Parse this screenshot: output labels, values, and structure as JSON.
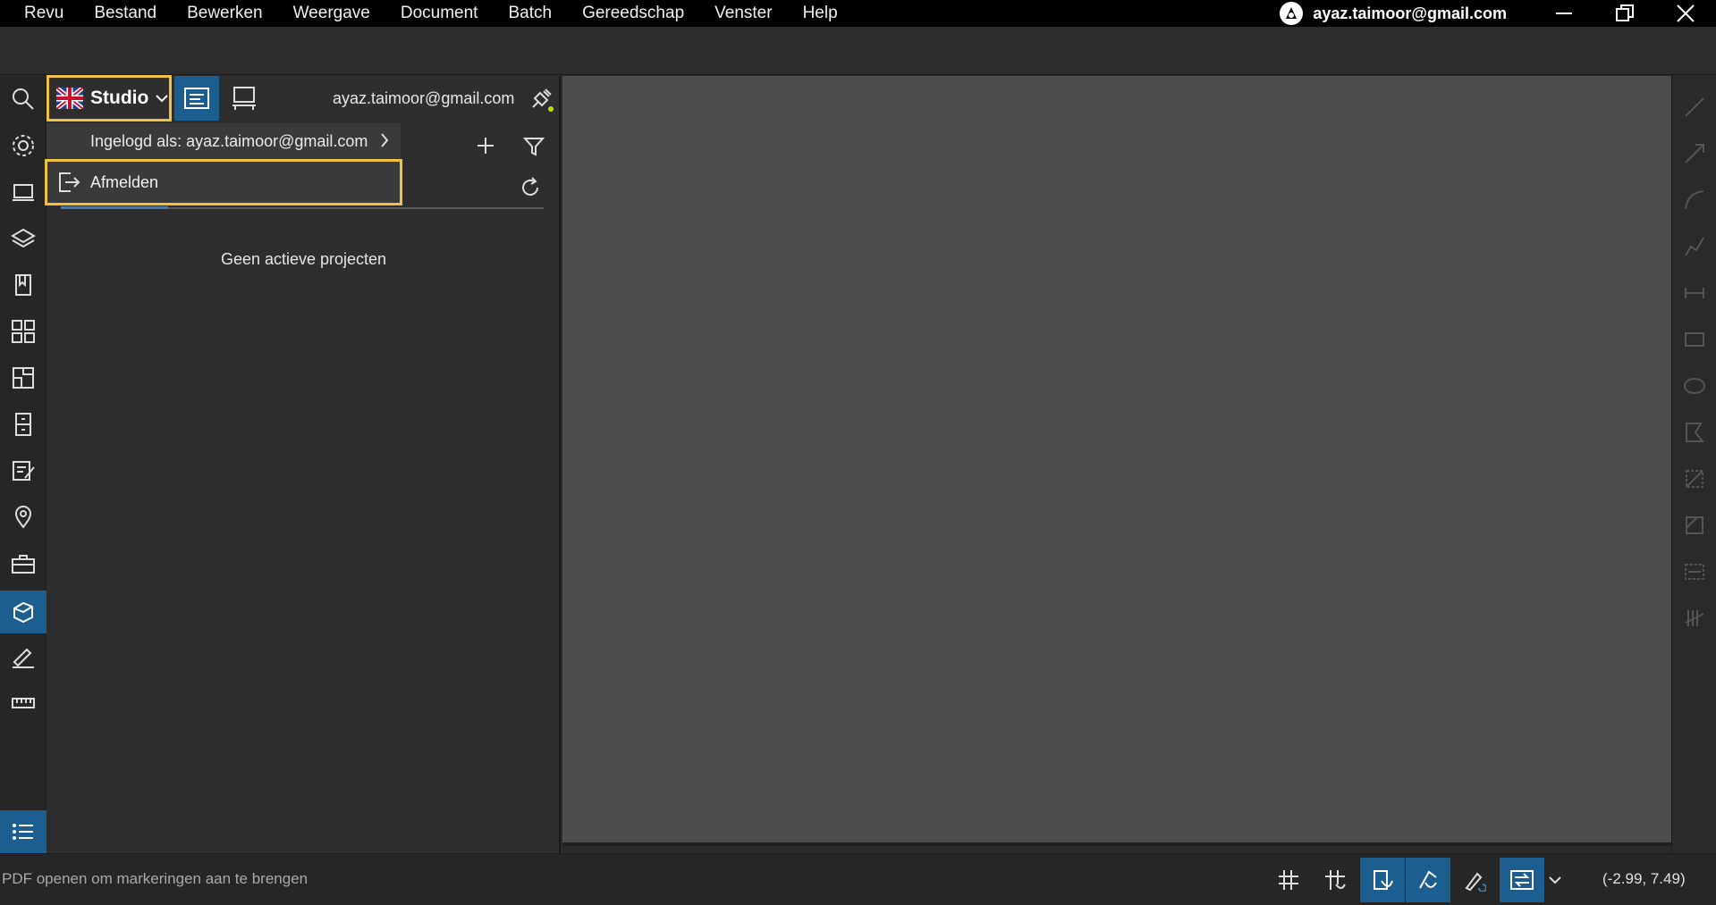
{
  "menubar": {
    "items": [
      "Revu",
      "Bestand",
      "Bewerken",
      "Weergave",
      "Document",
      "Batch",
      "Gereedschap",
      "Venster",
      "Help"
    ],
    "account": "ayaz.taimoor@gmail.com"
  },
  "studio": {
    "label": "Studio",
    "user_email": "ayaz.taimoor@gmail.com",
    "dropdown": {
      "logged_in_as": "Ingelogd als: ayaz.taimoor@gmail.com",
      "logout": "Afmelden"
    },
    "empty_message": "Geen actieve projecten"
  },
  "status": {
    "message": "PDF openen om markeringen aan te brengen",
    "coordinates": "(-2.99, 7.49)"
  },
  "colors": {
    "accent": "#1d5e91",
    "highlight": "#f0c243",
    "canvas": "#4d4d4d"
  }
}
